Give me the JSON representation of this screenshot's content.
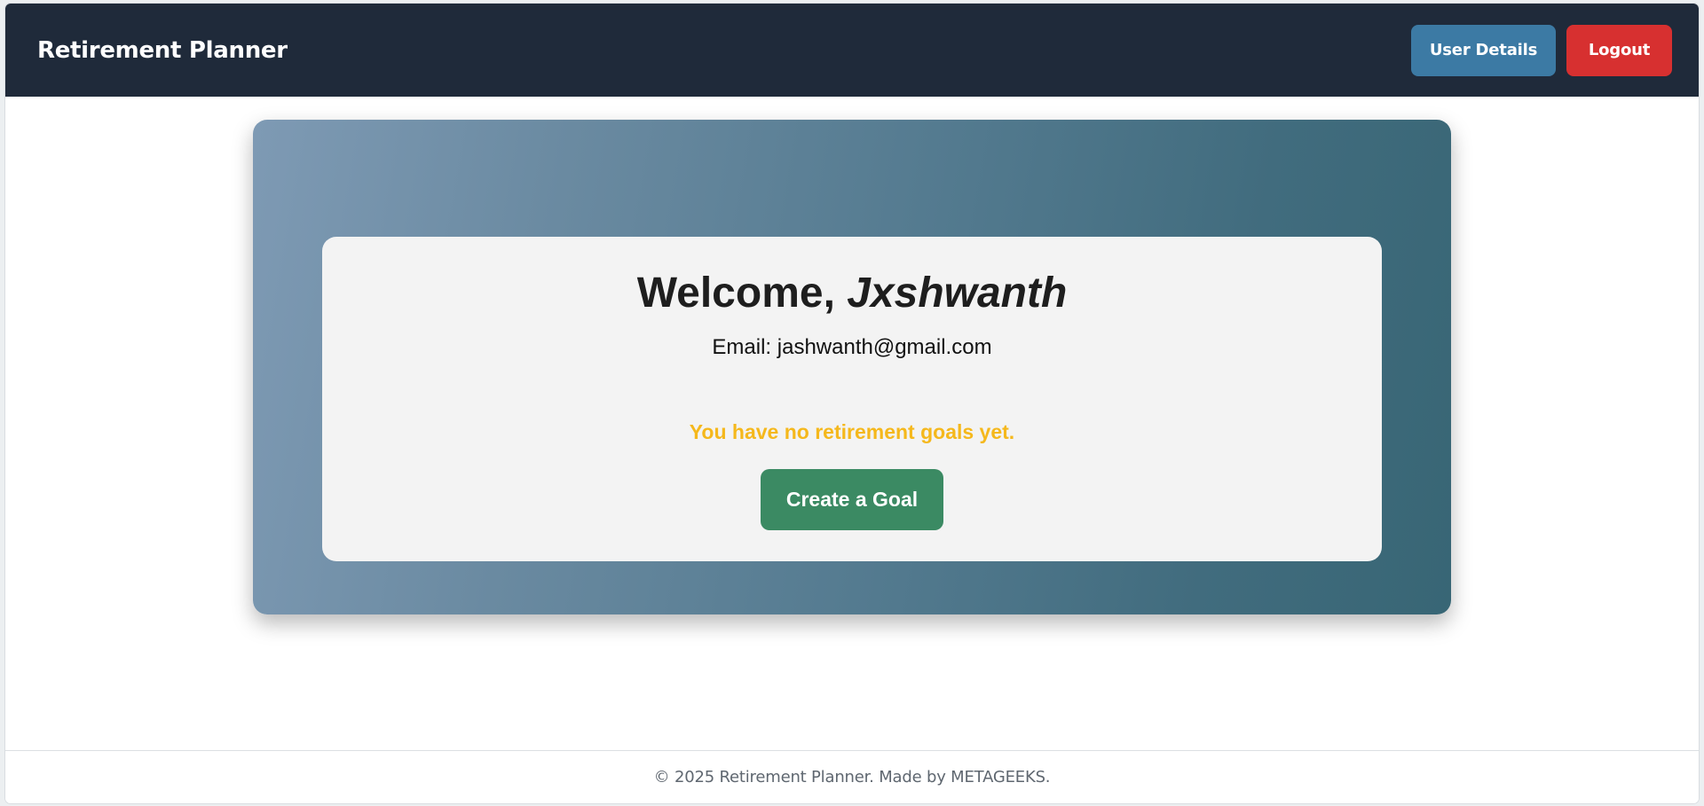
{
  "navbar": {
    "brand": "Retirement Planner",
    "user_details_label": "User Details",
    "logout_label": "Logout"
  },
  "welcome": {
    "greeting": "Welcome, ",
    "username": "Jxshwanth",
    "email_line": "Email: jashwanth@gmail.com"
  },
  "goals": {
    "empty_message": "You have no retirement goals yet.",
    "create_label": "Create a Goal"
  },
  "footer": {
    "text": "© 2025 Retirement Planner. Made by METAGEEKS."
  },
  "colors": {
    "navbar": "#1f2a3a",
    "user_details_button": "#3c7aa4",
    "logout_button": "#d73030",
    "create_button": "#3b8a63",
    "empty_message": "#f5b81c"
  }
}
